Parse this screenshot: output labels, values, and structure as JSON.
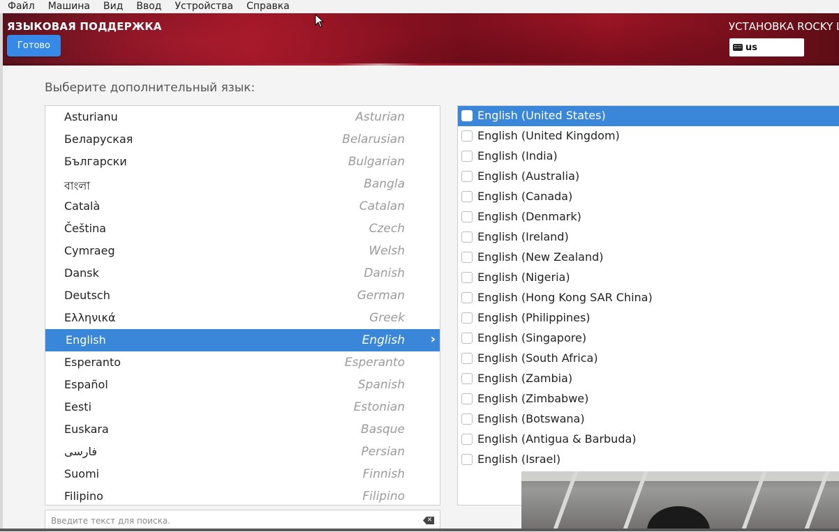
{
  "menubar": {
    "items": [
      "Файл",
      "Машина",
      "Вид",
      "Ввод",
      "Устройства",
      "Справка"
    ]
  },
  "header": {
    "title": "ЯЗЫКОВАЯ ПОДДЕРЖКА",
    "done_label": "Готово",
    "install_title": "УСТАНОВКА ROCKY L",
    "keyboard_layout": "us"
  },
  "prompt": "Выберите дополнительный язык:",
  "languages": [
    {
      "native": "Asturianu",
      "english": "Asturian"
    },
    {
      "native": "Беларуская",
      "english": "Belarusian"
    },
    {
      "native": "Български",
      "english": "Bulgarian"
    },
    {
      "native": "বাংলা",
      "english": "Bangla"
    },
    {
      "native": "Català",
      "english": "Catalan"
    },
    {
      "native": "Čeština",
      "english": "Czech"
    },
    {
      "native": "Cymraeg",
      "english": "Welsh"
    },
    {
      "native": "Dansk",
      "english": "Danish"
    },
    {
      "native": "Deutsch",
      "english": "German"
    },
    {
      "native": "Ελληνικά",
      "english": "Greek"
    },
    {
      "native": "English",
      "english": "English"
    },
    {
      "native": "Esperanto",
      "english": "Esperanto"
    },
    {
      "native": "Español",
      "english": "Spanish"
    },
    {
      "native": "Eesti",
      "english": "Estonian"
    },
    {
      "native": "Euskara",
      "english": "Basque"
    },
    {
      "native": "فارسی",
      "english": "Persian"
    },
    {
      "native": "Suomi",
      "english": "Finnish"
    },
    {
      "native": "Filipino",
      "english": "Filipino"
    }
  ],
  "selected_language_index": 10,
  "search": {
    "placeholder": "Введите текст для поиска."
  },
  "locales": [
    "English (United States)",
    "English (United Kingdom)",
    "English (India)",
    "English (Australia)",
    "English (Canada)",
    "English (Denmark)",
    "English (Ireland)",
    "English (New Zealand)",
    "English (Nigeria)",
    "English (Hong Kong SAR China)",
    "English (Philippines)",
    "English (Singapore)",
    "English (South Africa)",
    "English (Zambia)",
    "English (Zimbabwe)",
    "English (Botswana)",
    "English (Antigua & Barbuda)",
    "English (Israel)"
  ],
  "selected_locale_index": 0,
  "colors": {
    "accent": "#3a86d8",
    "done_button": "#3689e6",
    "header_red": "#9c1525"
  },
  "icons": {
    "keyboard": "keyboard-icon",
    "arrow": "chevron-right-icon",
    "clear": "clear-text-icon"
  }
}
